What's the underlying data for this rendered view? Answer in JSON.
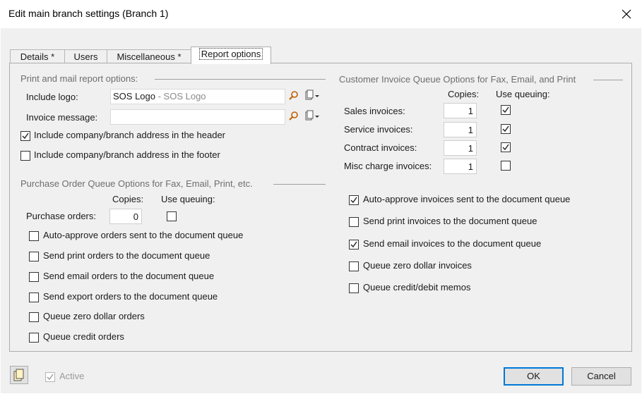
{
  "window": {
    "title": "Edit main branch settings (Branch 1)"
  },
  "tabs": [
    {
      "label": "Details *"
    },
    {
      "label": "Users"
    },
    {
      "label": "Miscellaneous *"
    },
    {
      "label": "Report options",
      "active": true
    }
  ],
  "print_mail": {
    "group_title": "Print and mail report options:",
    "include_logo_label": "Include logo:",
    "include_logo_value": "SOS Logo",
    "include_logo_desc": " - SOS Logo",
    "invoice_message_label": "Invoice message:",
    "invoice_message_value": "",
    "address_header": {
      "label": "Include company/branch address in the header",
      "checked": true
    },
    "address_footer": {
      "label": "Include company/branch address in the footer",
      "checked": false
    }
  },
  "purchase_orders": {
    "group_title": "Purchase Order Queue Options for Fax, Email, Print, etc.",
    "copies_header": "Copies:",
    "use_queuing_header": "Use queuing:",
    "row_label": "Purchase orders:",
    "copies": "0",
    "use_queuing": false,
    "options": [
      {
        "label": "Auto-approve orders sent to the document queue",
        "checked": false
      },
      {
        "label": "Send print orders to the document queue",
        "checked": false
      },
      {
        "label": "Send email orders to the document queue",
        "checked": false
      },
      {
        "label": "Send export orders to the document queue",
        "checked": false
      },
      {
        "label": "Queue zero dollar orders",
        "checked": false
      },
      {
        "label": "Queue credit orders",
        "checked": false
      }
    ]
  },
  "customer_invoice": {
    "group_title": "Customer Invoice Queue Options for Fax, Email, and Print",
    "copies_header": "Copies:",
    "use_queuing_header": "Use queuing:",
    "rows": [
      {
        "label": "Sales invoices:",
        "copies": "1",
        "use_queuing": true
      },
      {
        "label": "Service invoices:",
        "copies": "1",
        "use_queuing": true
      },
      {
        "label": "Contract invoices:",
        "copies": "1",
        "use_queuing": true
      },
      {
        "label": "Misc charge invoices:",
        "copies": "1",
        "use_queuing": false
      }
    ],
    "options": [
      {
        "label": "Auto-approve invoices sent to the document queue",
        "checked": true
      },
      {
        "label": "Send print invoices to the document queue",
        "checked": false
      },
      {
        "label": "Send email invoices to the document queue",
        "checked": true
      },
      {
        "label": "Queue zero dollar invoices",
        "checked": false
      },
      {
        "label": "Queue credit/debit memos",
        "checked": false
      }
    ]
  },
  "footer": {
    "active_label": "Active",
    "active_checked": true,
    "ok_label": "OK",
    "cancel_label": "Cancel"
  },
  "icons": [
    "close-icon",
    "search-icon",
    "lookup-dropdown-icon",
    "copy-icon",
    "check-icon"
  ]
}
